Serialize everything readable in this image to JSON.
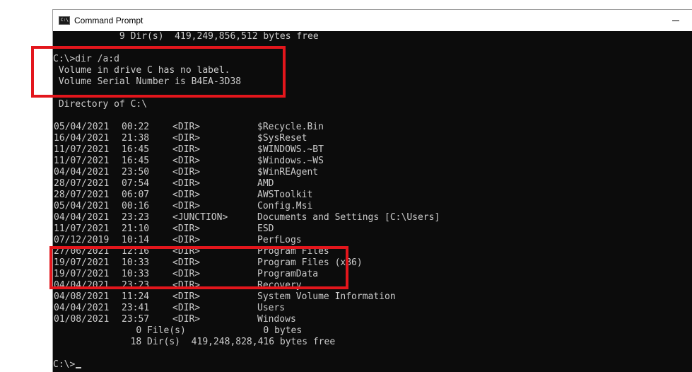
{
  "window": {
    "title": "Command Prompt",
    "icon": "cmd-icon"
  },
  "console": {
    "top_line": "            9 Dir(s)  419,249,856,512 bytes free",
    "command": "C:\\>dir /a:d",
    "volume_label": " Volume in drive C has no label.",
    "serial": " Volume Serial Number is B4EA-3D38",
    "directory_of": " Directory of C:\\",
    "entries": [
      {
        "date": "05/04/2021",
        "time": "00:22",
        "type": "<DIR>",
        "name": "$Recycle.Bin"
      },
      {
        "date": "16/04/2021",
        "time": "21:38",
        "type": "<DIR>",
        "name": "$SysReset"
      },
      {
        "date": "11/07/2021",
        "time": "16:45",
        "type": "<DIR>",
        "name": "$WINDOWS.~BT"
      },
      {
        "date": "11/07/2021",
        "time": "16:45",
        "type": "<DIR>",
        "name": "$Windows.~WS"
      },
      {
        "date": "04/04/2021",
        "time": "23:50",
        "type": "<DIR>",
        "name": "$WinREAgent"
      },
      {
        "date": "28/07/2021",
        "time": "07:54",
        "type": "<DIR>",
        "name": "AMD"
      },
      {
        "date": "28/07/2021",
        "time": "06:07",
        "type": "<DIR>",
        "name": "AWSToolkit"
      },
      {
        "date": "05/04/2021",
        "time": "00:16",
        "type": "<DIR>",
        "name": "Config.Msi"
      },
      {
        "date": "04/04/2021",
        "time": "23:23",
        "type": "<JUNCTION>",
        "name": "Documents and Settings [C:\\Users]"
      },
      {
        "date": "11/07/2021",
        "time": "21:10",
        "type": "<DIR>",
        "name": "ESD"
      },
      {
        "date": "07/12/2019",
        "time": "10:14",
        "type": "<DIR>",
        "name": "PerfLogs"
      },
      {
        "date": "27/06/2021",
        "time": "12:16",
        "type": "<DIR>",
        "name": "Program Files"
      },
      {
        "date": "19/07/2021",
        "time": "10:33",
        "type": "<DIR>",
        "name": "Program Files (x86)"
      },
      {
        "date": "19/07/2021",
        "time": "10:33",
        "type": "<DIR>",
        "name": "ProgramData"
      },
      {
        "date": "04/04/2021",
        "time": "23:23",
        "type": "<DIR>",
        "name": "Recovery"
      },
      {
        "date": "04/08/2021",
        "time": "11:24",
        "type": "<DIR>",
        "name": "System Volume Information"
      },
      {
        "date": "04/04/2021",
        "time": "23:41",
        "type": "<DIR>",
        "name": "Users"
      },
      {
        "date": "01/08/2021",
        "time": "23:57",
        "type": "<DIR>",
        "name": "Windows"
      }
    ],
    "files_summary": "               0 File(s)              0 bytes",
    "dirs_summary": "              18 Dir(s)  419,248,828,416 bytes free",
    "prompt": "C:\\>"
  },
  "colors": {
    "console_bg": "#0c0c0c",
    "console_text": "#cccccc",
    "highlight": "#e3161c"
  }
}
